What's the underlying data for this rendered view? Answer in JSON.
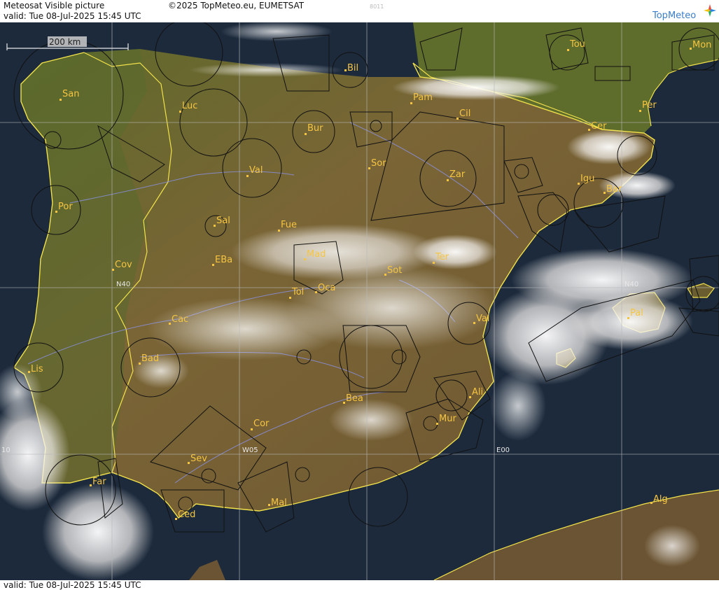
{
  "header": {
    "title": "Meteosat Visible picture",
    "valid": "valid:  Tue  08-Jul-2025  15:45 UTC",
    "copyright": "©2025 TopMeteo.eu, EUMETSAT",
    "code": "8011",
    "brand": "TopMeteo"
  },
  "footer": {
    "valid": "valid:  Tue  08-Jul-2025  15:45 UTC"
  },
  "map": {
    "scale_label": "200 km",
    "grid_labels": {
      "lat_n40_left": "N40",
      "lat_n40_right": "N40",
      "lon_w05": "W05",
      "lon_e00": "E00",
      "lon_w10": "10"
    },
    "cities": {
      "bil": "Bil",
      "tou": "Tou",
      "mon": "Mon",
      "san": "San",
      "pam": "Pam",
      "luc": "Luc",
      "cil": "Cil",
      "per": "Per",
      "bur": "Bur",
      "cer": "Cer",
      "sor": "Sor",
      "val_n": "Val",
      "zar": "Zar",
      "igu": "Igu",
      "bar": "Bar",
      "por": "Por",
      "sal": "Sal",
      "fue": "Fue",
      "mad": "Mad",
      "ter": "Ter",
      "cov": "Cov",
      "eba": "EBa",
      "sot": "Sot",
      "tol": "Tol",
      "oca": "Oca",
      "pal": "Pal",
      "cac": "Cac",
      "val_e": "Val",
      "bad": "Bad",
      "lis": "Lis",
      "ali": "Ali",
      "bea": "Bea",
      "mur": "Mur",
      "cor": "Cor",
      "sev": "Sev",
      "far": "Far",
      "mal": "Mal",
      "ced": "Ced",
      "alg": "Alg"
    }
  }
}
